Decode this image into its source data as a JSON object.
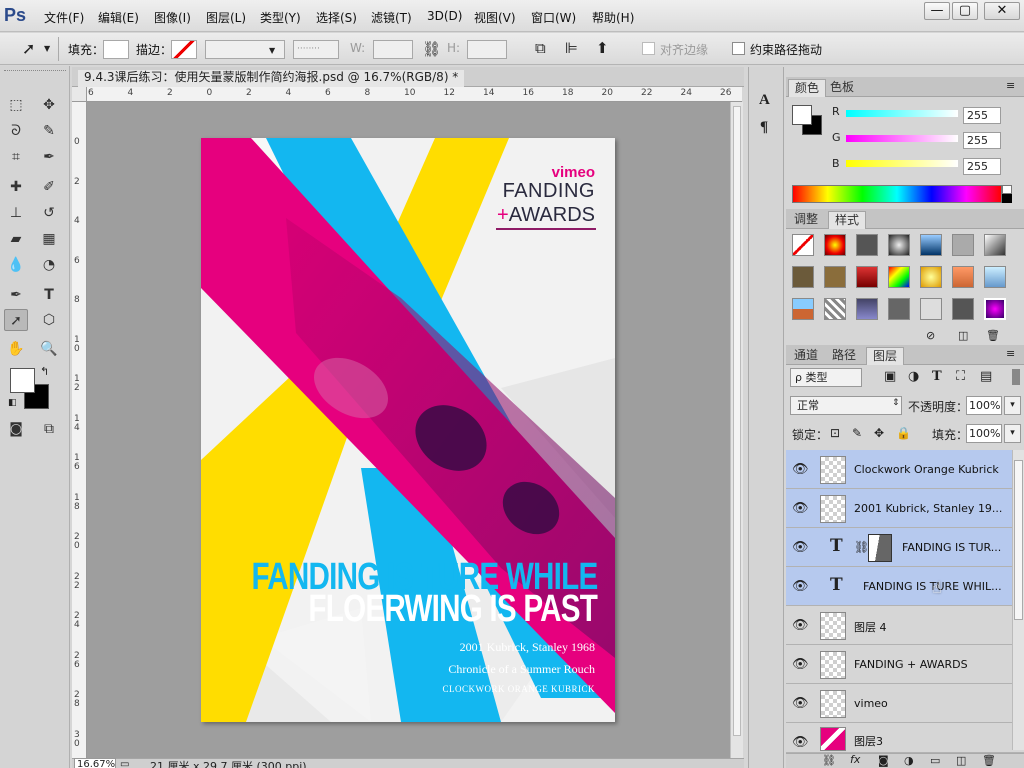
{
  "app": {
    "logo": "Ps",
    "window_buttons": [
      "—",
      "▢",
      "✕"
    ]
  },
  "menu": [
    "文件(F)",
    "编辑(E)",
    "图像(I)",
    "图层(L)",
    "类型(Y)",
    "选择(S)",
    "滤镜(T)",
    "3D(D)",
    "视图(V)",
    "窗口(W)",
    "帮助(H)"
  ],
  "options": {
    "fill_label": "填充：",
    "stroke_label": "描边：",
    "w_label": "W:",
    "h_label": "H:",
    "align_edges": "对齐边缘",
    "constrain_path": "约束路径拖动"
  },
  "document": {
    "tab_title": "9.4.3课后练习：使用矢量蒙版制作简约海报.psd @ 16.7%(RGB/8) *",
    "zoom": "16.67%",
    "doc_size": "21 厘米 x 29.7 厘米 (300 ppi)",
    "hruler_ticks": [
      "6",
      "4",
      "2",
      "0",
      "2",
      "4",
      "6",
      "8",
      "10",
      "12",
      "14",
      "16",
      "18",
      "20",
      "22",
      "24",
      "26"
    ],
    "vruler_ticks": [
      "0",
      "2",
      "4",
      "6",
      "8",
      "10",
      "12",
      "14",
      "16",
      "18",
      "20",
      "22",
      "24",
      "26",
      "28",
      "30"
    ]
  },
  "poster": {
    "brand": "vimeo",
    "title_line1": "FANDING",
    "title_plus": "+",
    "title_line2": "AWARDS",
    "headline1": "FANDING IS TURE WHILE",
    "headline2": "FLOERWING IS PAST",
    "credit1": "2001 Kubrick, Stanley  1968",
    "credit2": "Chronicle of a Summer Rouch",
    "credit3": "CLOCKWORK ORANGE KUBRICK",
    "colors": {
      "magenta": "#e6007e",
      "cyan": "#13b7f0",
      "yellow": "#ffdd00"
    }
  },
  "color_panel": {
    "tabs": [
      "颜色",
      "色板"
    ],
    "channels": [
      {
        "label": "R",
        "value": "255"
      },
      {
        "label": "G",
        "value": "255"
      },
      {
        "label": "B",
        "value": "255"
      }
    ]
  },
  "styles_panel": {
    "tabs": [
      "调整",
      "样式"
    ]
  },
  "layers_panel": {
    "tabs": [
      "通道",
      "路径",
      "图层"
    ],
    "filter_kind": "ρ 类型",
    "blend_mode": "正常",
    "opacity_label": "不透明度：",
    "opacity": "100%",
    "lock_label": "锁定：",
    "fill_label": "填充：",
    "fill": "100%",
    "layers": [
      {
        "name": "Clockwork Orange Kubrick",
        "type": "pixel",
        "selected": true
      },
      {
        "name": "2001 Kubrick, Stanley  19...",
        "type": "pixel",
        "selected": true
      },
      {
        "name": "FANDING IS TUR...",
        "type": "text-mask",
        "selected": true
      },
      {
        "name": "FANDING IS TURE WHIL...",
        "type": "text",
        "selected": true
      },
      {
        "name": "图层 4",
        "type": "pixel",
        "selected": false
      },
      {
        "name": "FANDING + AWARDS",
        "type": "pixel",
        "selected": false
      },
      {
        "name": "vimeo",
        "type": "pixel",
        "selected": false
      },
      {
        "name": "图层3",
        "type": "image",
        "selected": false
      }
    ]
  }
}
